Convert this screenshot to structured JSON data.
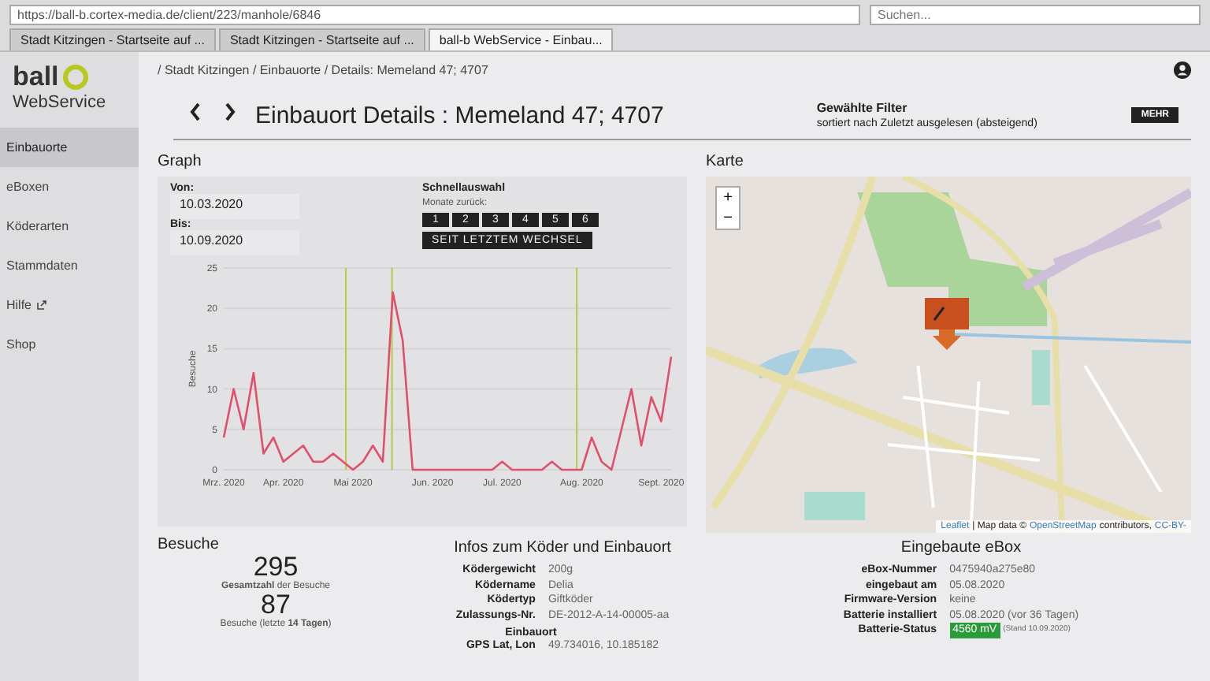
{
  "browser": {
    "url": "https://ball-b.cortex-media.de/client/223/manhole/6846",
    "search_placeholder": "Suchen...",
    "tabs": [
      {
        "title": "Stadt Kitzingen - Startseite auf ...",
        "selected": false
      },
      {
        "title": "Stadt Kitzingen - Startseite auf ...",
        "selected": false
      },
      {
        "title": "ball-b WebService - Einbau...",
        "selected": true
      }
    ]
  },
  "sidebar": {
    "logo_text": "ball",
    "logo_subtitle": "WebService",
    "items": [
      {
        "label": "Einbauorte",
        "selected": true,
        "kind": "link"
      },
      {
        "label": "eBoxen",
        "selected": false,
        "kind": "link"
      },
      {
        "label": "Köderarten",
        "selected": false,
        "kind": "link"
      },
      {
        "label": "Stammdaten",
        "selected": false,
        "kind": "link"
      },
      {
        "label": "Hilfe",
        "selected": false,
        "kind": "external"
      },
      {
        "label": "Shop",
        "selected": false,
        "kind": "link"
      }
    ]
  },
  "breadcrumb": "/ Stadt Kitzingen / Einbauorte / Details: Memeland 47; 4707",
  "page_title": "Einbauort Details : Memeland 47; 4707",
  "filter": {
    "title": "Gewählte Filter",
    "description": "sortiert nach Zuletzt ausgelesen (absteigend)"
  },
  "more_button": "MEHR",
  "graph": {
    "title": "Graph",
    "from_label": "Von:",
    "from_value": "10.03.2020",
    "to_label": "Bis:",
    "to_value": "10.09.2020",
    "quick_select_title": "Schnellauswahl",
    "months_label": "Monate zurück:",
    "month_buttons": [
      "1",
      "2",
      "3",
      "4",
      "5",
      "6"
    ],
    "since_change_button": "SEIT LETZTEM WECHSEL",
    "chart_data": {
      "type": "line",
      "ylabel": "Besuche",
      "categories": [
        "Mrz. 2020",
        null,
        null,
        null,
        null,
        null,
        "Apr. 2020",
        null,
        null,
        null,
        null,
        null,
        null,
        "Mai 2020",
        null,
        null,
        null,
        null,
        null,
        null,
        null,
        "Jun. 2020",
        null,
        null,
        null,
        null,
        null,
        null,
        "Jul. 2020",
        null,
        null,
        null,
        null,
        null,
        null,
        null,
        "Aug. 2020",
        null,
        null,
        null,
        null,
        null,
        null,
        null,
        "Sept. 2020",
        null
      ],
      "series": [
        {
          "color": "#e0506a",
          "values": [
            4,
            10,
            5,
            12,
            2,
            4,
            1,
            2,
            3,
            1,
            1,
            2,
            1,
            0,
            1,
            3,
            1,
            22,
            16,
            0,
            0,
            0,
            0,
            0,
            0,
            0,
            0,
            0,
            1,
            0,
            0,
            0,
            0,
            1,
            0,
            0,
            0,
            4,
            1,
            0,
            5,
            10,
            3,
            9,
            6,
            14
          ]
        }
      ],
      "ylim": [
        0,
        25
      ],
      "yticks": [
        0,
        5,
        10,
        15,
        20,
        25
      ],
      "grid": true
    }
  },
  "map": {
    "title": "Karte",
    "zoom_in": "+",
    "zoom_out": "−",
    "attribution_leaflet": "Leaflet",
    "attribution_text": "| Map data ©",
    "attribution_osm": "OpenStreetMap",
    "attribution_contributors": "contributors,",
    "attribution_license": "CC-BY-"
  },
  "visits": {
    "title": "Besuche",
    "total": "295",
    "total_label": "**Gesamtzahl** der Besuche",
    "recent": "87",
    "recent_label": "Besuche (letzte **14 Tagen**)"
  },
  "info": {
    "title": "Infos zum Köder und Einbauort",
    "rows": [
      {
        "label": "Ködergewicht",
        "value": "200g"
      },
      {
        "label": "Ködername",
        "value": "Delia"
      },
      {
        "label": "Ködertyp",
        "value": "Giftköder"
      },
      {
        "label": "Zulassungs-Nr.",
        "value": "DE-2012-A-14-00005-aa"
      }
    ],
    "location_title": "Einbauort",
    "location_rows": [
      {
        "label": "GPS Lat, Lon",
        "value": "49.734016, 10.185182"
      }
    ]
  },
  "ebox": {
    "title": "Eingebaute eBox",
    "rows": [
      {
        "label": "eBox-Nummer",
        "value": "0475940a275e80"
      },
      {
        "label": "eingebaut am",
        "value": "05.08.2020"
      },
      {
        "label": "Firmware-Version",
        "value": "keine"
      },
      {
        "label": "Batterie installiert",
        "value": "05.08.2020 (vor 36 Tagen)"
      }
    ],
    "battery_label": "Batterie-Status",
    "battery_value": "4560 mV",
    "battery_ok": true,
    "battery_note": "(Stand 10.09.2020)"
  }
}
